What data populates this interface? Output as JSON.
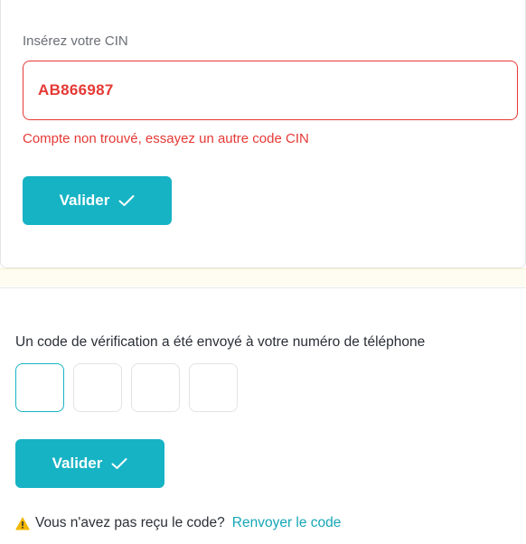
{
  "cin_section": {
    "label": "Insérez votre CIN",
    "input_value": "AB866987",
    "error_message": "Compte non trouvé, essayez un autre code CIN",
    "submit_label": "Valider"
  },
  "verification_section": {
    "message": "Un code de vérification a été envoyé à votre numéro de téléphone",
    "code_boxes": [
      "",
      "",
      "",
      ""
    ],
    "submit_label": "Valider",
    "resend_prompt": "Vous n'avez pas reçu le code?",
    "resend_link": "Renvoyer le code"
  },
  "colors": {
    "accent": "#16b3c4",
    "error": "#e53935",
    "warning": "#f2b705"
  },
  "icons": {
    "button_icon": "check-icon",
    "resend_icon": "warning-icon"
  }
}
